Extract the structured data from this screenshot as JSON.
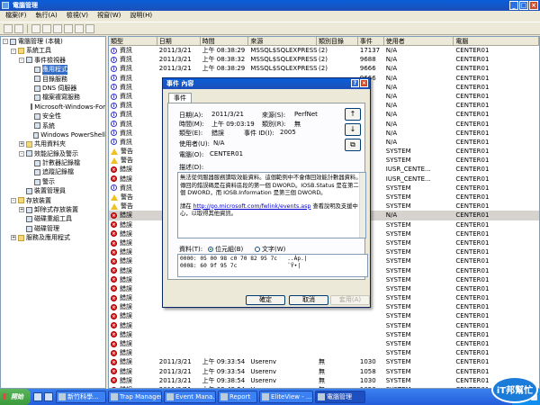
{
  "window": {
    "title": "電腦管理"
  },
  "menu": [
    "檔案(F)",
    "執行(A)",
    "檢視(V)",
    "視窗(W)",
    "說明(H)"
  ],
  "tree": [
    {
      "label": "電腦管理 (本機)",
      "indent": 0,
      "exp": "-",
      "folder": false
    },
    {
      "label": "系統工具",
      "indent": 1,
      "exp": "-",
      "folder": true
    },
    {
      "label": "事件檢視器",
      "indent": 2,
      "exp": "-",
      "folder": false
    },
    {
      "label": "應用程式",
      "indent": 3,
      "exp": "",
      "folder": false,
      "selected": true
    },
    {
      "label": "目錄服務",
      "indent": 3,
      "exp": "",
      "folder": false
    },
    {
      "label": "DNS 伺服器",
      "indent": 3,
      "exp": "",
      "folder": false
    },
    {
      "label": "檔案複寫服務",
      "indent": 3,
      "exp": "",
      "folder": false
    },
    {
      "label": "Microsoft-Windows-For",
      "indent": 3,
      "exp": "",
      "folder": false
    },
    {
      "label": "安全性",
      "indent": 3,
      "exp": "",
      "folder": false
    },
    {
      "label": "系統",
      "indent": 3,
      "exp": "",
      "folder": false
    },
    {
      "label": "Windows PowerShell",
      "indent": 3,
      "exp": "",
      "folder": false
    },
    {
      "label": "共用資料夾",
      "indent": 2,
      "exp": "+",
      "folder": true
    },
    {
      "label": "效能記錄及警示",
      "indent": 2,
      "exp": "-",
      "folder": false
    },
    {
      "label": "計數器記錄檔",
      "indent": 3,
      "exp": "",
      "folder": false
    },
    {
      "label": "追蹤記錄檔",
      "indent": 3,
      "exp": "",
      "folder": false
    },
    {
      "label": "警示",
      "indent": 3,
      "exp": "",
      "folder": false
    },
    {
      "label": "裝置管理員",
      "indent": 2,
      "exp": "",
      "folder": false
    },
    {
      "label": "存放裝置",
      "indent": 1,
      "exp": "-",
      "folder": true
    },
    {
      "label": "卸除式存放裝置",
      "indent": 2,
      "exp": "+",
      "folder": false
    },
    {
      "label": "磁碟重組工具",
      "indent": 2,
      "exp": "",
      "folder": false
    },
    {
      "label": "磁碟管理",
      "indent": 2,
      "exp": "",
      "folder": false
    },
    {
      "label": "服務及應用程式",
      "indent": 1,
      "exp": "+",
      "folder": true
    }
  ],
  "list": {
    "headers": [
      "類型",
      "日期",
      "時間",
      "來源",
      "類別目錄",
      "事件",
      "使用者",
      "電腦"
    ],
    "rows": [
      {
        "sev": "info",
        "type": "資訊",
        "date": "2011/3/21",
        "time": "上午 08:38:29",
        "src": "MSSQL$SQLEXPRESS",
        "cat": "(2)",
        "ev": "17137",
        "user": "N/A",
        "pc": "CENTER01"
      },
      {
        "sev": "info",
        "type": "資訊",
        "date": "2011/3/21",
        "time": "上午 08:38:32",
        "src": "MSSQL$SQLEXPRESS",
        "cat": "(2)",
        "ev": "9688",
        "user": "N/A",
        "pc": "CENTER01"
      },
      {
        "sev": "info",
        "type": "資訊",
        "date": "2011/3/21",
        "time": "上午 08:38:29",
        "src": "MSSQL$SQLEXPRESS",
        "cat": "(2)",
        "ev": "9666",
        "user": "N/A",
        "pc": "CENTER01"
      },
      {
        "sev": "info",
        "type": "資訊",
        "date": "",
        "time": "",
        "src": "",
        "cat": "",
        "ev": "9666",
        "user": "N/A",
        "pc": "CENTER01"
      },
      {
        "sev": "info",
        "type": "資訊",
        "date": "",
        "time": "",
        "src": "",
        "cat": "",
        "ev": "",
        "user": "N/A",
        "pc": "CENTER01"
      },
      {
        "sev": "info",
        "type": "資訊",
        "date": "",
        "time": "",
        "src": "",
        "cat": "",
        "ev": "",
        "user": "N/A",
        "pc": "CENTER01"
      },
      {
        "sev": "info",
        "type": "資訊",
        "date": "",
        "time": "",
        "src": "",
        "cat": "",
        "ev": "",
        "user": "N/A",
        "pc": "CENTER01"
      },
      {
        "sev": "info",
        "type": "資訊",
        "date": "",
        "time": "",
        "src": "",
        "cat": "",
        "ev": "",
        "user": "N/A",
        "pc": "CENTER01"
      },
      {
        "sev": "info",
        "type": "資訊",
        "date": "",
        "time": "",
        "src": "",
        "cat": "",
        "ev": "",
        "user": "N/A",
        "pc": "CENTER01"
      },
      {
        "sev": "info",
        "type": "資訊",
        "date": "",
        "time": "",
        "src": "",
        "cat": "",
        "ev": "",
        "user": "N/A",
        "pc": "CENTER01"
      },
      {
        "sev": "info",
        "type": "資訊",
        "date": "",
        "time": "",
        "src": "",
        "cat": "",
        "ev": "",
        "user": "N/A",
        "pc": "CENTER01"
      },
      {
        "sev": "warn",
        "type": "警告",
        "date": "",
        "time": "",
        "src": "",
        "cat": "",
        "ev": "",
        "user": "SYSTEM",
        "pc": "CENTER01"
      },
      {
        "sev": "warn",
        "type": "警告",
        "date": "",
        "time": "",
        "src": "",
        "cat": "",
        "ev": "",
        "user": "SYSTEM",
        "pc": "CENTER01"
      },
      {
        "sev": "err",
        "type": "錯誤",
        "date": "",
        "time": "",
        "src": "",
        "cat": "",
        "ev": "",
        "user": "IUSR_CENTE...",
        "pc": "CENTER01"
      },
      {
        "sev": "err",
        "type": "錯誤",
        "date": "",
        "time": "",
        "src": "",
        "cat": "",
        "ev": "",
        "user": "IUSR_CENTE...",
        "pc": "CENTER01"
      },
      {
        "sev": "info",
        "type": "資訊",
        "date": "",
        "time": "",
        "src": "",
        "cat": "",
        "ev": "",
        "user": "SYSTEM",
        "pc": "CENTER01"
      },
      {
        "sev": "warn",
        "type": "警告",
        "date": "",
        "time": "",
        "src": "",
        "cat": "",
        "ev": "",
        "user": "SYSTEM",
        "pc": "CENTER01"
      },
      {
        "sev": "warn",
        "type": "警告",
        "date": "",
        "time": "",
        "src": "",
        "cat": "",
        "ev": "",
        "user": "SYSTEM",
        "pc": "CENTER01"
      },
      {
        "sev": "err",
        "type": "錯誤",
        "date": "",
        "time": "",
        "src": "",
        "cat": "",
        "ev": "",
        "user": "N/A",
        "pc": "CENTER01",
        "sel": true
      },
      {
        "sev": "err",
        "type": "錯誤",
        "date": "",
        "time": "",
        "src": "",
        "cat": "",
        "ev": "",
        "user": "SYSTEM",
        "pc": "CENTER01"
      },
      {
        "sev": "err",
        "type": "錯誤",
        "date": "",
        "time": "",
        "src": "",
        "cat": "",
        "ev": "",
        "user": "SYSTEM",
        "pc": "CENTER01"
      },
      {
        "sev": "err",
        "type": "錯誤",
        "date": "",
        "time": "",
        "src": "",
        "cat": "",
        "ev": "",
        "user": "SYSTEM",
        "pc": "CENTER01"
      },
      {
        "sev": "err",
        "type": "錯誤",
        "date": "",
        "time": "",
        "src": "",
        "cat": "",
        "ev": "",
        "user": "SYSTEM",
        "pc": "CENTER01"
      },
      {
        "sev": "err",
        "type": "錯誤",
        "date": "",
        "time": "",
        "src": "",
        "cat": "",
        "ev": "",
        "user": "SYSTEM",
        "pc": "CENTER01"
      },
      {
        "sev": "err",
        "type": "錯誤",
        "date": "",
        "time": "",
        "src": "",
        "cat": "",
        "ev": "",
        "user": "SYSTEM",
        "pc": "CENTER01"
      },
      {
        "sev": "err",
        "type": "錯誤",
        "date": "",
        "time": "",
        "src": "",
        "cat": "",
        "ev": "",
        "user": "SYSTEM",
        "pc": "CENTER01"
      },
      {
        "sev": "err",
        "type": "錯誤",
        "date": "",
        "time": "",
        "src": "",
        "cat": "",
        "ev": "",
        "user": "SYSTEM",
        "pc": "CENTER01"
      },
      {
        "sev": "err",
        "type": "錯誤",
        "date": "",
        "time": "",
        "src": "",
        "cat": "",
        "ev": "",
        "user": "SYSTEM",
        "pc": "CENTER01"
      },
      {
        "sev": "err",
        "type": "錯誤",
        "date": "",
        "time": "",
        "src": "",
        "cat": "",
        "ev": "",
        "user": "SYSTEM",
        "pc": "CENTER01"
      },
      {
        "sev": "err",
        "type": "錯誤",
        "date": "",
        "time": "",
        "src": "",
        "cat": "",
        "ev": "",
        "user": "SYSTEM",
        "pc": "CENTER01"
      },
      {
        "sev": "err",
        "type": "錯誤",
        "date": "",
        "time": "",
        "src": "",
        "cat": "",
        "ev": "",
        "user": "SYSTEM",
        "pc": "CENTER01"
      },
      {
        "sev": "err",
        "type": "錯誤",
        "date": "",
        "time": "",
        "src": "",
        "cat": "",
        "ev": "",
        "user": "SYSTEM",
        "pc": "CENTER01"
      },
      {
        "sev": "err",
        "type": "錯誤",
        "date": "",
        "time": "",
        "src": "",
        "cat": "",
        "ev": "",
        "user": "SYSTEM",
        "pc": "CENTER01"
      },
      {
        "sev": "err",
        "type": "錯誤",
        "date": "",
        "time": "",
        "src": "",
        "cat": "",
        "ev": "",
        "user": "SYSTEM",
        "pc": "CENTER01"
      },
      {
        "sev": "err",
        "type": "錯誤",
        "date": "2011/3/21",
        "time": "上午 09:33:54",
        "src": "Userenv",
        "cat": "無",
        "ev": "1030",
        "user": "SYSTEM",
        "pc": "CENTER01"
      },
      {
        "sev": "err",
        "type": "錯誤",
        "date": "2011/3/21",
        "time": "上午 09:33:54",
        "src": "Userenv",
        "cat": "無",
        "ev": "1058",
        "user": "SYSTEM",
        "pc": "CENTER01"
      },
      {
        "sev": "err",
        "type": "錯誤",
        "date": "2011/3/21",
        "time": "上午 09:38:54",
        "src": "Userenv",
        "cat": "無",
        "ev": "1030",
        "user": "SYSTEM",
        "pc": "CENTER01"
      },
      {
        "sev": "err",
        "type": "錯誤",
        "date": "2011/3/21",
        "time": "上午 09:43:54",
        "src": "Userenv",
        "cat": "無",
        "ev": "1058",
        "user": "SYSTEM",
        "pc": "CENTER01"
      }
    ]
  },
  "dialog": {
    "title": "事件 內容",
    "tab": "事件",
    "date_k": "日期(A):",
    "date_v": "2011/3/21",
    "source_k": "來源(S):",
    "source_v": "PerfNet",
    "time_k": "時間(M):",
    "time_v": "上午 09:03:19",
    "cat_k": "類別(R):",
    "cat_v": "無",
    "type_k": "類型(E):",
    "type_v": "錯誤",
    "id_k": "事件 ID(I):",
    "id_v": "2005",
    "user_k": "使用者(U):",
    "user_v": "N/A",
    "pc_k": "電腦(O):",
    "pc_v": "CENTER01",
    "desc_label": "描述(D):",
    "desc_text": "無法從伺服器服務讀取效能資料。這個範例中不會傳回效能計數器資料。傳回的錯誤碼是在資料區段的第一個 DWORD。IOSB.Status 是在第二個 DWORD，而 IOSB.Information 是第三個 DWORD。",
    "desc_more_prefix": "請在 ",
    "desc_link": "http://go.microsoft.com/fwlink/events.asp",
    "desc_more_suffix": " 查看說明及支援中心，以取得其他資訊。",
    "data_label": "資料(T):",
    "radio_bytes": "位元組(B)",
    "radio_words": "文字(W)",
    "hex_line1": "0000: 05 00 98 c0 70 82 95 7c   ..Àp.|",
    "hex_line2": "0008: 60 9f 95 7c               `Ÿ•|",
    "ok": "確定",
    "cancel": "取消",
    "apply": "套用(A)"
  },
  "taskbar": {
    "start": "開始",
    "tasks": [
      "新竹科學...",
      "Trap Manager",
      "Event Mana...",
      "Report",
      "EliteView - ...",
      "電腦管理"
    ],
    "watermark": "iT邦幫忙"
  }
}
